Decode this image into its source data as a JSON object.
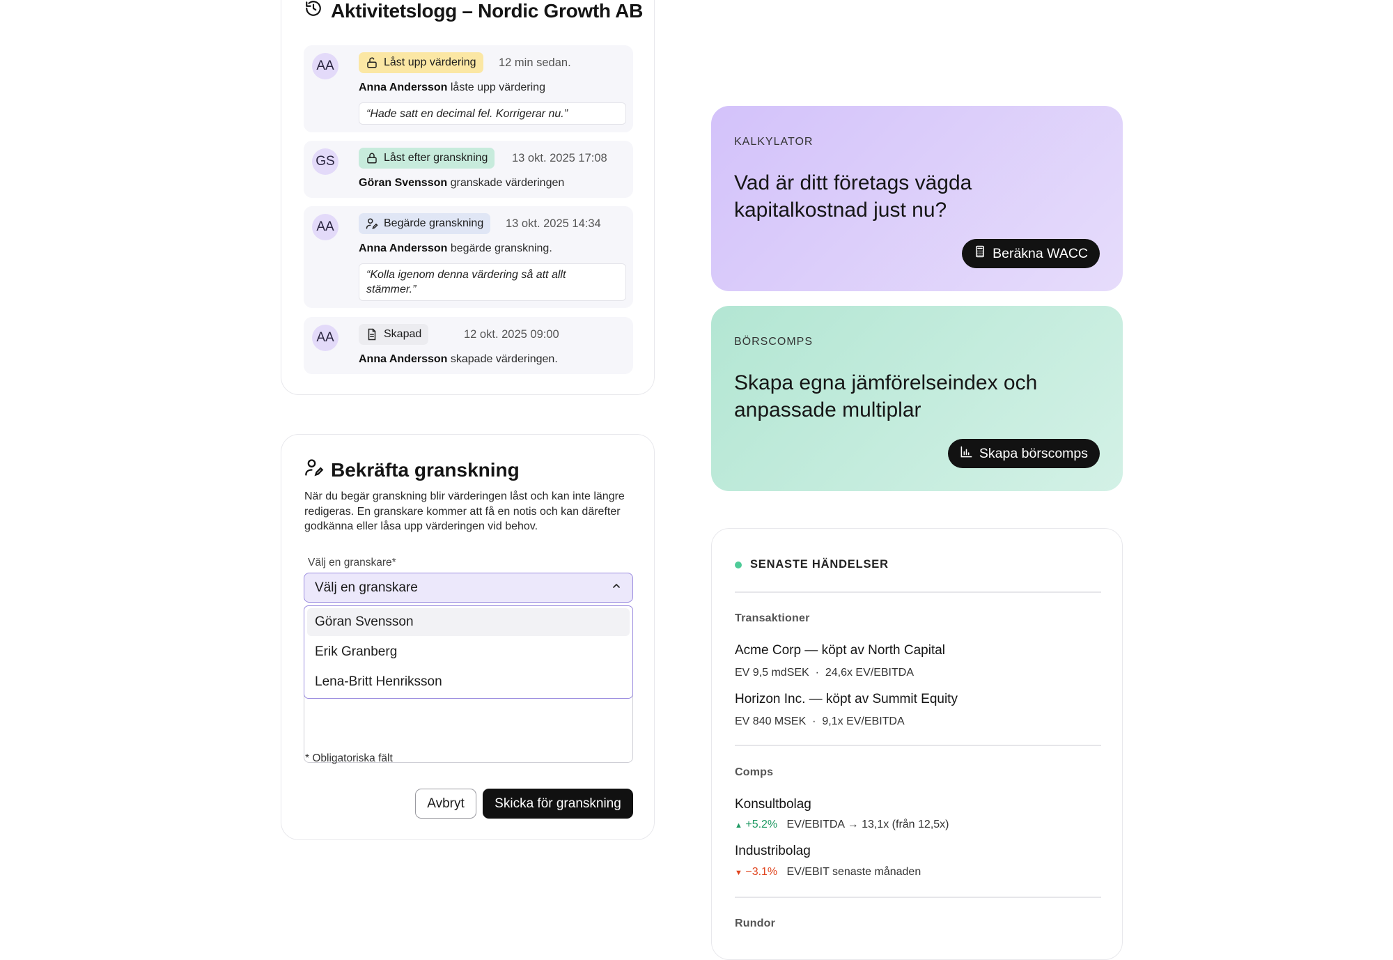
{
  "activity": {
    "title": "Aktivitetslogg – Nordic Growth AB",
    "entries": [
      {
        "initials": "AA",
        "badge": "Låst upp värdering",
        "time": "12 min sedan.",
        "name": "Anna Andersson",
        "action": "låste upp värdering",
        "note": "“Hade satt en decimal fel. Korrigerar nu.”"
      },
      {
        "initials": "GS",
        "badge": "Låst efter granskning",
        "time": "13 okt. 2025 17:08",
        "name": "Göran Svensson",
        "action": "granskade värderingen"
      },
      {
        "initials": "AA",
        "badge": "Begärde granskning",
        "time": "13 okt. 2025 14:34",
        "name": "Anna Andersson",
        "action": "begärde granskning.",
        "note": "“Kolla igenom denna värdering så att allt stämmer.”"
      },
      {
        "initials": "AA",
        "badge": "Skapad",
        "time": "12 okt. 2025 09:00",
        "name": "Anna Andersson",
        "action": "skapade värderingen."
      }
    ]
  },
  "confirm": {
    "title": "Bekräfta granskning",
    "description": "När du begär granskning blir värderingen låst och kan inte längre redigeras. En granskare kommer att få en notis och kan därefter godkänna eller låsa upp värderingen vid behov.",
    "field_label": "Välj en granskare*",
    "select_value": "Välj en granskare",
    "options": [
      "Göran Svensson",
      "Erik Granberg",
      "Lena-Britt Henriksson"
    ],
    "required_note": "* Obligatoriska fält",
    "cancel_label": "Avbryt",
    "submit_label": "Skicka för granskning"
  },
  "promos": {
    "wacc": {
      "eyebrow": "KALKYLATOR",
      "headline": "Vad är ditt företags vägda kapitalkostnad just nu?",
      "button": "Beräkna WACC"
    },
    "comps": {
      "eyebrow": "BÖRSCOMPS",
      "headline": "Skapa egna jämförelseindex och anpassade multiplar",
      "button": "Skapa börscomps"
    }
  },
  "events": {
    "title": "SENASTE HÄNDELSER",
    "transactions_label": "Transaktioner",
    "transactions": [
      {
        "company": "Acme Corp",
        "detail": " — köpt av North Capital",
        "ev": "EV 9,5 mdSEK",
        "sep": "·",
        "multiple": "24,6x EV/EBITDA"
      },
      {
        "company": "Horizon Inc.",
        "detail": " — köpt av Summit Equity",
        "ev": "EV 840 MSEK",
        "sep": "·",
        "multiple": "9,1x EV/EBITDA"
      }
    ],
    "comps_label": "Comps",
    "comps": [
      {
        "name": "Konsultbolag",
        "change": "+5.2%",
        "detail": "EV/EBITDA → 13,1x (från 12,5x)"
      },
      {
        "name": "Industribolag",
        "change": "−3.1%",
        "detail": "EV/EBIT senaste månaden"
      }
    ],
    "rounds_label": "Rundor"
  },
  "colors": {
    "accent_purple": "#9b8cdf",
    "badge_yellow": "#fbe7a4",
    "badge_green": "#c7ebdc",
    "up": "#1f9a63",
    "down": "#e0451f",
    "live_dot": "#4ecb98"
  }
}
